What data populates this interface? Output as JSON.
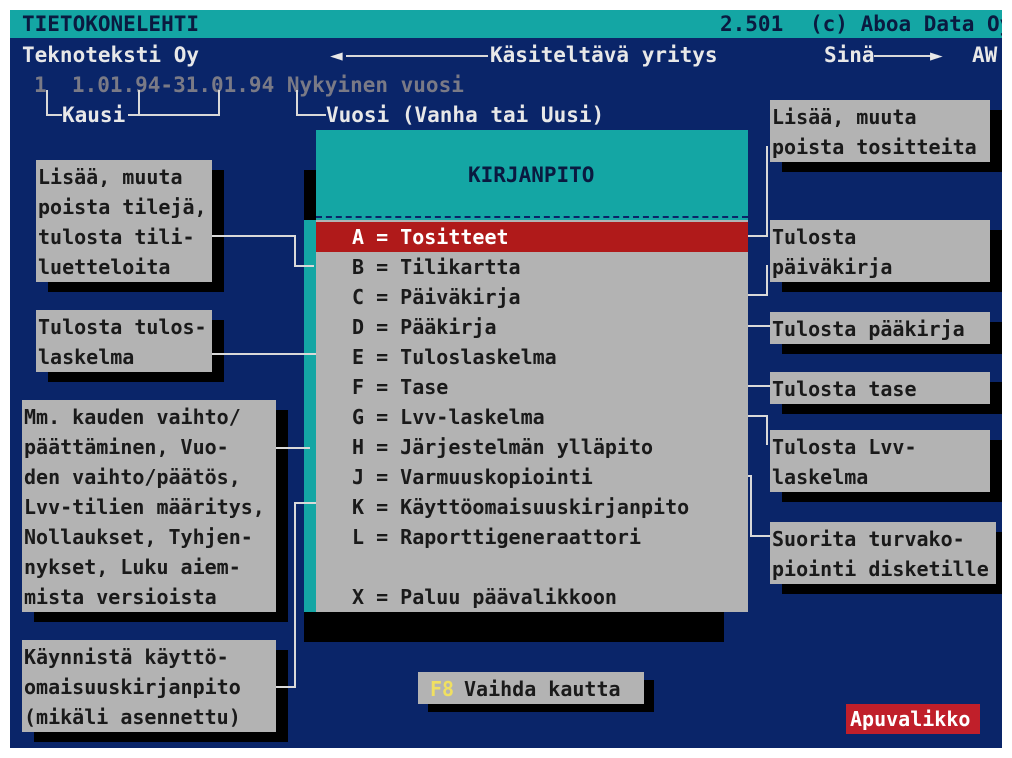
{
  "topbar": {
    "title": "TIETOKONELEHTI",
    "version": "2.501",
    "copyright": "(c) Aboa Data Oy"
  },
  "status": {
    "company": "Teknoteksti Oy",
    "company_label": "Käsiteltävä yritys",
    "user_label": "Sinä",
    "user": "AW",
    "period_line": "1  1.01.94-31.01.94 Nykyinen vuosi",
    "period_label": "Kausi",
    "year_label": "Vuosi (Vanha tai Uusi)"
  },
  "menu": {
    "title": "KIRJANPITO",
    "items": [
      {
        "label": "A = Tositteet",
        "selected": true
      },
      {
        "label": "B = Tilikartta"
      },
      {
        "label": "C = Päiväkirja"
      },
      {
        "label": "D = Pääkirja"
      },
      {
        "label": "E = Tuloslaskelma"
      },
      {
        "label": "F = Tase"
      },
      {
        "label": "G = Lvv-laskelma"
      },
      {
        "label": "H = Järjestelmän ylläpito"
      },
      {
        "label": "J = Varmuuskopiointi"
      },
      {
        "label": "K = Käyttöomaisuuskirjanpito"
      },
      {
        "label": "L = Raporttigeneraattori"
      }
    ],
    "exit": "X = Paluu päävalikkoon"
  },
  "hints": {
    "left": [
      "Lisää, muuta\npoista tilejä,\ntulosta tili-\nluetteloita",
      "Tulosta tulos-\nlaskelma",
      "Mm. kauden vaihto/\npäättäminen, Vuo-\nden vaihto/päätös,\nLvv-tilien määritys,\nNollaukset, Tyhjen-\nnykset, Luku aiem-\nmista versioista",
      "Käynnistä käyttö-\nomaisuuskirjanpito\n(mikäli asennettu)"
    ],
    "right": [
      "Lisää, muuta\npoista tositteita",
      "Tulosta\npäiväkirja",
      "Tulosta pääkirja",
      "Tulosta tase",
      "Tulosta Lvv-\nlaskelma",
      "Suorita turvako-\npiointi disketille"
    ]
  },
  "footer": {
    "key": "F8",
    "change_label": "Vaihda kautta",
    "help_button": "Apuvalikko"
  },
  "colors": {
    "background": "#0a2569",
    "cyan": "#14a6a4",
    "panel": "#b3b3b3",
    "highlight": "#b01a1a",
    "key": "#f0e060"
  }
}
